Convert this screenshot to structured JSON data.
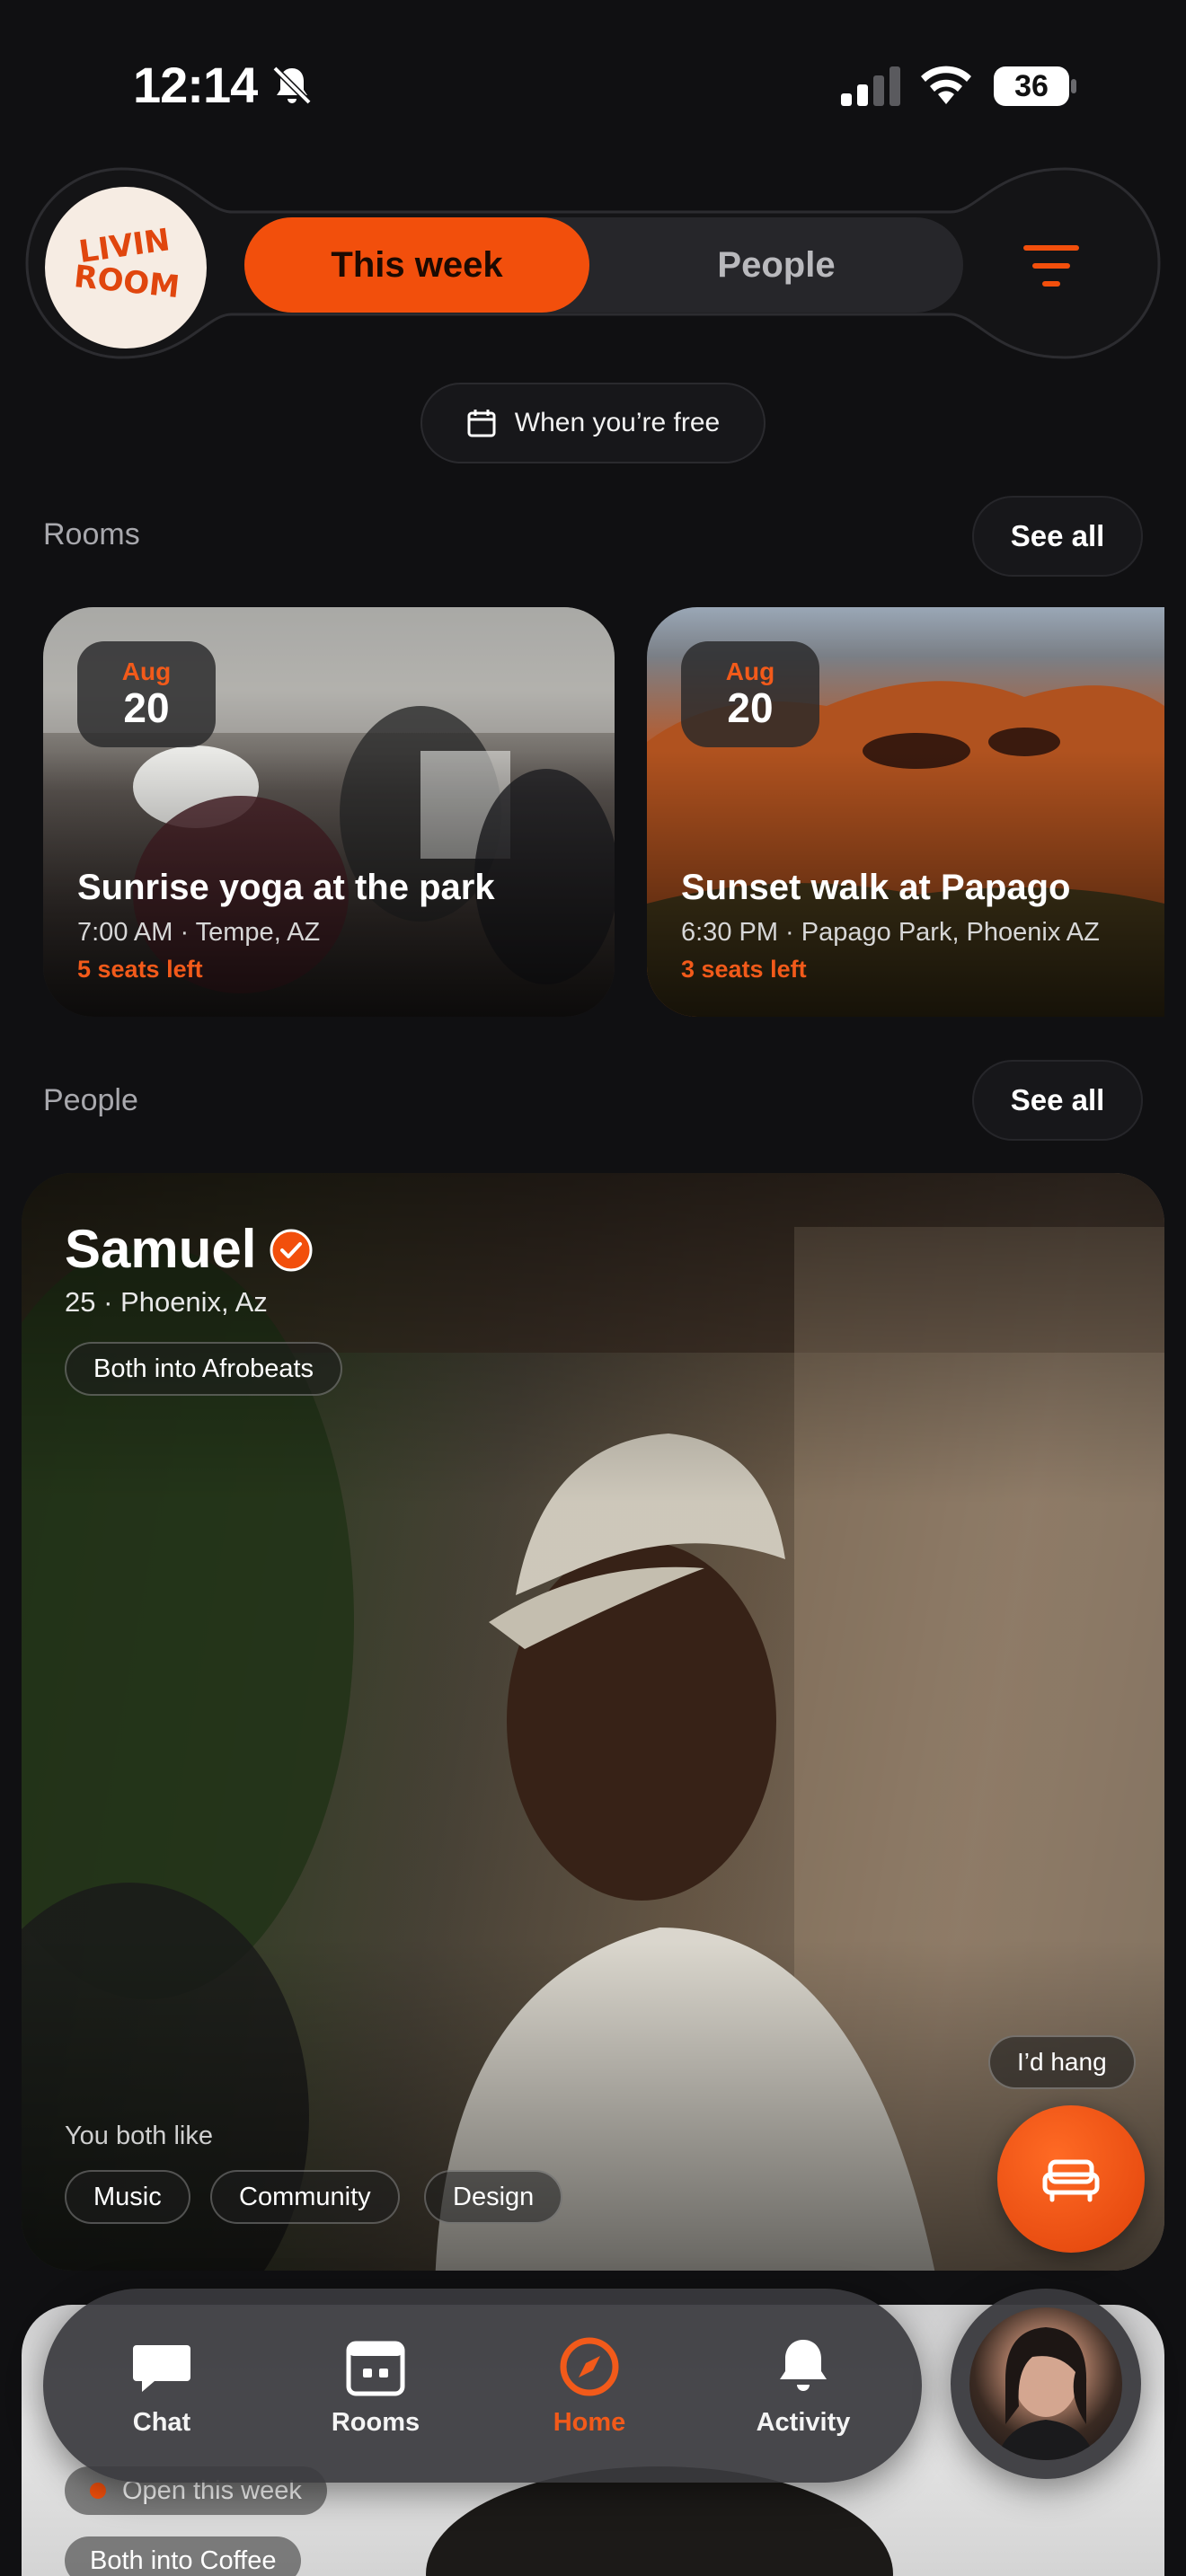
{
  "status_bar": {
    "time": "12:14",
    "battery": "36",
    "icons": [
      "bell-off-icon",
      "signal-icon",
      "wifi-icon",
      "battery-icon"
    ]
  },
  "header": {
    "logo_text": "LIVIN ROOM",
    "tabs": [
      {
        "label": "This week",
        "active": true
      },
      {
        "label": "People",
        "active": false
      }
    ],
    "filter_icon": "filter-icon"
  },
  "availability_chip": {
    "label": "When you’re free",
    "icon": "calendar-icon"
  },
  "rooms_section": {
    "title": "Rooms",
    "see_all": "See all",
    "items": [
      {
        "month": "Aug",
        "day": "20",
        "title": "Sunrise yoga at the park",
        "meta": "7:00 AM · Tempe, AZ",
        "seats": "5 seats left"
      },
      {
        "month": "Aug",
        "day": "20",
        "title": "Sunset walk at Papago",
        "meta": "6:30 PM · Papago Park, Phoenix AZ",
        "seats": "3 seats left"
      }
    ]
  },
  "people_section": {
    "title": "People",
    "see_all": "See all",
    "person": {
      "name": "Samuel",
      "verified": true,
      "meta": "25 · Phoenix, Az",
      "shared_tag": "Both into Afrobeats",
      "both_like_label": "You both like",
      "likes": [
        "Music",
        "Community",
        "Design"
      ],
      "hang_label": "I’d hang"
    },
    "next_person": {
      "status": "Open this week",
      "shared_tag": "Both into Coffee"
    }
  },
  "tab_bar": {
    "items": [
      {
        "label": "Chat",
        "icon": "chat-icon",
        "active": false
      },
      {
        "label": "Rooms",
        "icon": "calendar-icon",
        "active": false
      },
      {
        "label": "Home",
        "icon": "compass-icon",
        "active": true
      },
      {
        "label": "Activity",
        "icon": "bell-icon",
        "active": false
      }
    ]
  },
  "colors": {
    "accent": "#F24F0C",
    "background": "#101012"
  }
}
